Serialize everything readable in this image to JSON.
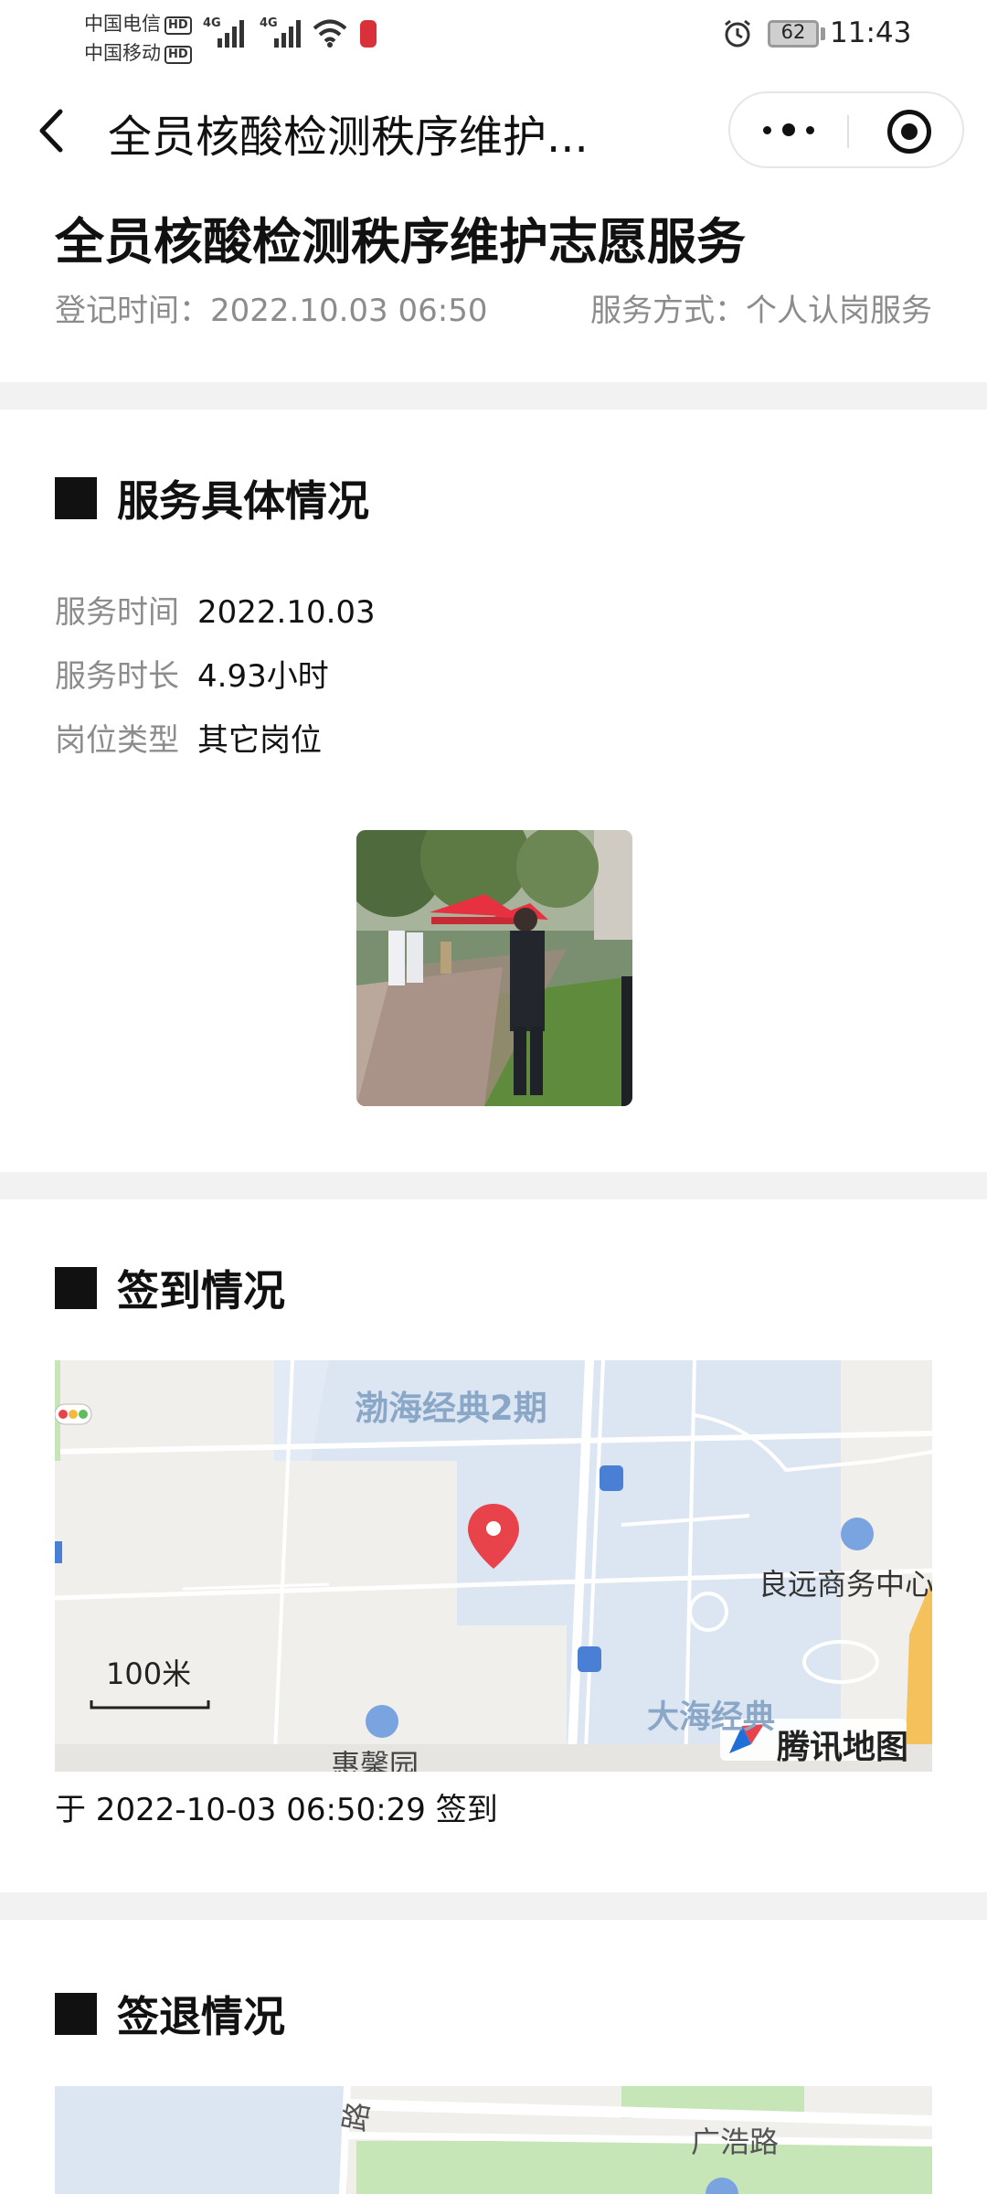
{
  "status_bar": {
    "carrier1": "中国电信",
    "carrier2": "中国移动",
    "hd": "HD",
    "network": "4G",
    "battery": "62",
    "time": "11:43"
  },
  "nav": {
    "title": "全员核酸检测秩序维护..."
  },
  "header": {
    "title": "全员核酸检测秩序维护志愿服务",
    "registered": "登记时间：2022.10.03 06:50",
    "service_mode": "服务方式：个人认岗服务"
  },
  "details": {
    "section_title": "服务具体情况",
    "rows": [
      {
        "label": "服务时间",
        "value": "2022.10.03"
      },
      {
        "label": "服务时长",
        "value": "4.93小时"
      },
      {
        "label": "岗位类型",
        "value": "其它岗位"
      }
    ]
  },
  "checkin": {
    "section_title": "签到情况",
    "map": {
      "label_north": "渤海经典2期",
      "label_east": "良远商务中心",
      "label_south": "大海经典",
      "label_southwest": "惠馨园",
      "scale": "100米",
      "provider": "腾讯地图"
    },
    "text": "于 2022-10-03 06:50:29 签到"
  },
  "checkout": {
    "section_title": "签退情况",
    "map": {
      "road1": "广浩路",
      "road2": "路"
    }
  },
  "colors": {
    "accent_marker": "#e8424a",
    "section_gap": "#f2f2f2",
    "muted_text": "#8c8c8c"
  }
}
